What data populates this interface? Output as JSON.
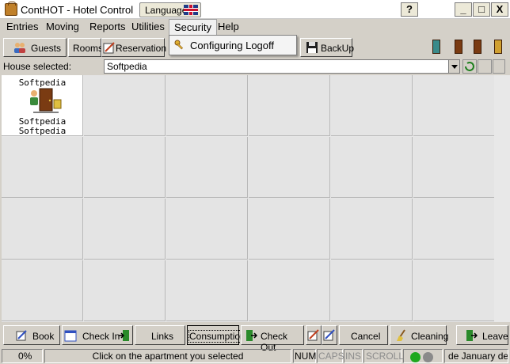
{
  "window": {
    "title": "ContHOT - Hotel Control",
    "language_label": "Language",
    "help_button": "?",
    "minimize": "_",
    "maximize": "□",
    "close": "X"
  },
  "menu": {
    "items": [
      "Entries",
      "Moving",
      "Reports",
      "Utilities",
      "Security",
      "Help"
    ],
    "active": "Security",
    "dropdown": {
      "items": [
        "Configuring Logoff"
      ]
    }
  },
  "toolbar": {
    "guests": "Guests",
    "rooms": "Rooms",
    "reservation": "Reservation",
    "backup": "BackUp"
  },
  "house": {
    "label": "House selected:",
    "value": "Softpedia"
  },
  "apartment": {
    "name": "Softpedia",
    "line2": "Softpedia",
    "line3": "Softpedia"
  },
  "bottom_buttons": {
    "book": "Book",
    "check_in": "Check In",
    "links": "Links",
    "consumption": "Consumption",
    "check_out": "Check Out",
    "cancel": "Cancel",
    "cleaning": "Cleaning",
    "leave": "Leave"
  },
  "status": {
    "progress": "0%",
    "message": "Click on the apartment you selected",
    "num": "NUM",
    "caps": "CAPS",
    "ins": "INS",
    "scroll": "SCROLL",
    "date": "de January de"
  },
  "icons": {
    "app": "suitcase-icon",
    "flag": "uk-flag-icon",
    "guests": "people-icon",
    "reservation": "calendar-pencil-icon",
    "backup": "floppy-disk-icon",
    "doors": [
      "exit-door-icon",
      "room-door-icon",
      "open-door-icon",
      "door-leave-icon"
    ]
  },
  "colors": {
    "window_bg": "#d4d0c8",
    "grid_cell": "#e4e4e4",
    "selected_cell": "#ffffff",
    "door": "#7a3b12",
    "led_green": "#1ea81e",
    "led_gray": "#8a8a8a"
  }
}
